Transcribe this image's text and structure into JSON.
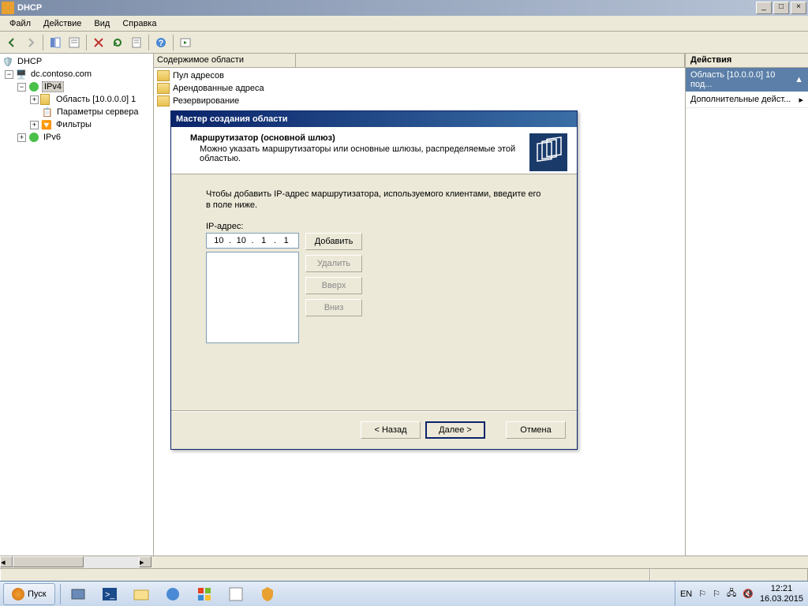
{
  "window": {
    "title": "DHCP"
  },
  "menu": {
    "file": "Файл",
    "action": "Действие",
    "view": "Вид",
    "help": "Справка"
  },
  "tree": {
    "root": "DHCP",
    "server": "dc.contoso.com",
    "ipv4": "IPv4",
    "scope": "Область [10.0.0.0] 1",
    "server_params": "Параметры сервера",
    "filters": "Фильтры",
    "ipv6": "IPv6"
  },
  "content": {
    "header": "Содержимое области",
    "items": [
      "Пул адресов",
      "Арендованные адреса",
      "Резервирование"
    ]
  },
  "actions": {
    "header": "Действия",
    "scope": "Область [10.0.0.0] 10 под...",
    "more": "Дополнительные дейст..."
  },
  "wizard": {
    "title": "Мастер создания области",
    "header_title": "Маршрутизатор (основной шлюз)",
    "header_desc": "Можно указать маршрутизаторы или основные шлюзы, распределяемые этой областью.",
    "instruction": "Чтобы добавить IP-адрес маршрутизатора, используемого клиентами, введите его в поле ниже.",
    "ip_label": "IP-адрес:",
    "ip": {
      "o1": "10",
      "o2": "10",
      "o3": "1",
      "o4": "1"
    },
    "btn_add": "Добавить",
    "btn_remove": "Удалить",
    "btn_up": "Вверх",
    "btn_down": "Вниз",
    "btn_back": "< Назад",
    "btn_next": "Далее >",
    "btn_cancel": "Отмена"
  },
  "taskbar": {
    "start": "Пуск",
    "lang": "EN",
    "time": "12:21",
    "date": "16.03.2015"
  }
}
